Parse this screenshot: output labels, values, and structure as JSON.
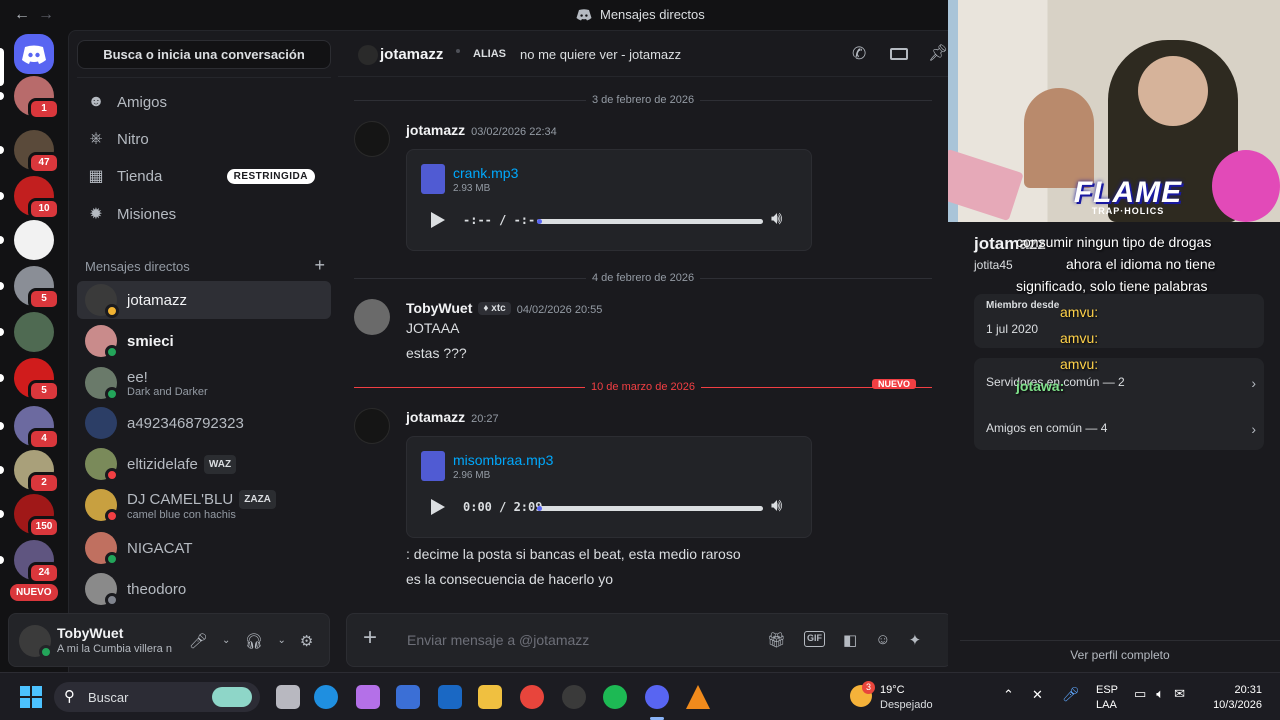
{
  "titlebar": {
    "back": "←",
    "forward": "→",
    "title": "Mensajes directos"
  },
  "servers": [
    {
      "badge": "1",
      "color": "#b86b6b"
    },
    {
      "badge": "47",
      "color": "#5a4a3a"
    },
    {
      "badge": "10",
      "color": "#c21f1f"
    },
    {
      "badge": "",
      "color": "#f2f2f2"
    },
    {
      "badge": "5",
      "color": "#8a8e96"
    },
    {
      "badge": "",
      "color": "#4f6a52"
    },
    {
      "badge": "5",
      "color": "#d01c1c"
    },
    {
      "badge": "4",
      "color": "#6c6aa0"
    },
    {
      "badge": "2",
      "color": "#a9a07a"
    },
    {
      "badge": "150",
      "color": "#a01818"
    },
    {
      "badge": "24",
      "color": "#5f5580"
    }
  ],
  "servers_new_label": "NUEVO",
  "dm_panel": {
    "search": "Busca o inicia una conversación",
    "nav": [
      {
        "label": "Amigos",
        "icon": "person-wave-icon"
      },
      {
        "label": "Nitro",
        "icon": "nitro-icon"
      },
      {
        "label": "Tienda",
        "icon": "shop-icon",
        "tag": "RESTRINGIDA"
      },
      {
        "label": "Misiones",
        "icon": "quests-icon"
      }
    ],
    "header": "Mensajes directos",
    "add": "+",
    "dms": [
      {
        "name": "jotamazz",
        "sub": "",
        "tag": "",
        "status": "#f0b232",
        "active": true,
        "color": "#3a3a3a"
      },
      {
        "name": "smieci",
        "sub": "",
        "tag": "",
        "status": "#23a55a",
        "active": false,
        "color": "#c98b8b"
      },
      {
        "name": "ee!",
        "sub": "Dark and Darker",
        "tag": "",
        "status": "#23a55a",
        "active": false,
        "color": "#6a7a6a"
      },
      {
        "name": "a4923468792323",
        "sub": "",
        "tag": "",
        "status": "",
        "active": false,
        "color": "#2c3e66"
      },
      {
        "name": "eltizidelafe",
        "sub": "",
        "tag": "WAZ",
        "status": "#f23f43",
        "active": false,
        "color": "#7a8a5a"
      },
      {
        "name": "DJ CAMEL'BLU",
        "sub": "camel blue con hachis",
        "tag": "ZAZA",
        "status": "#f23f43",
        "active": false,
        "color": "#c8a040"
      },
      {
        "name": "NIGACAT",
        "sub": "",
        "tag": "",
        "status": "#23a55a",
        "active": false,
        "color": "#c07060"
      },
      {
        "name": "theodoro",
        "sub": "",
        "tag": "",
        "status": "#80848e",
        "active": false,
        "color": "#8a8a8a"
      }
    ]
  },
  "user": {
    "name": "TobyWuet",
    "status": "A mi la Cumbia villera n"
  },
  "chat": {
    "recipient": "jotamazz",
    "alias_label": "ALIAS",
    "alias": "no me quiere ver - jotamazz",
    "date1": "3 de febrero de 2026",
    "m1": {
      "author": "jotamazz",
      "ts": "03/02/2026 22:34",
      "file": "crank.mp3",
      "size": "2.93 MB",
      "time": "-:-- / -:--",
      "progress": 0.0
    },
    "date2": "4 de febrero de 2026",
    "m2": {
      "author": "TobyWuet",
      "tag": "xtc",
      "ts": "04/02/2026 20:55",
      "lines": [
        "JOTAAA",
        "estas ???"
      ]
    },
    "date3": "10 de marzo de 2026",
    "new_label": "NUEVO",
    "m3": {
      "author": "jotamazz",
      "ts": "20:27",
      "file": "misombraa.mp3",
      "size": "2.96 MB",
      "time": "0:00 / 2:09",
      "progress": 0.0,
      "lines": [
        ": decime la posta si bancas el beat, esta medio raroso",
        "es la consecuencia de hacerlo yo"
      ]
    },
    "composer_placeholder": "Enviar mensaje a @jotamazz"
  },
  "profile": {
    "name": "jotamazz",
    "handle": "jotita45",
    "member_label": "Miembro desde",
    "member_date": "1 jul 2020",
    "servers_common": "Servidores en común — 2",
    "friends_common": "Amigos en común — 4",
    "view_full": "Ver perfil completo",
    "overlay_title": "FLAME",
    "overlay_sub": "TRAP·HOLICS",
    "chat_overlay": [
      "consumir ningun tipo de drogas",
      "ahora el idioma no tiene",
      "significado, solo tiene palabras",
      "amvu:",
      "amvu:",
      "amvu:",
      "jotawa:"
    ]
  },
  "taskbar": {
    "search": "Buscar",
    "weather_temp": "19°C",
    "weather_desc": "Despejado",
    "weather_badge": "3",
    "lang1": "ESP",
    "lang2": "LAA",
    "time": "20:31",
    "date": "10/3/2026"
  }
}
